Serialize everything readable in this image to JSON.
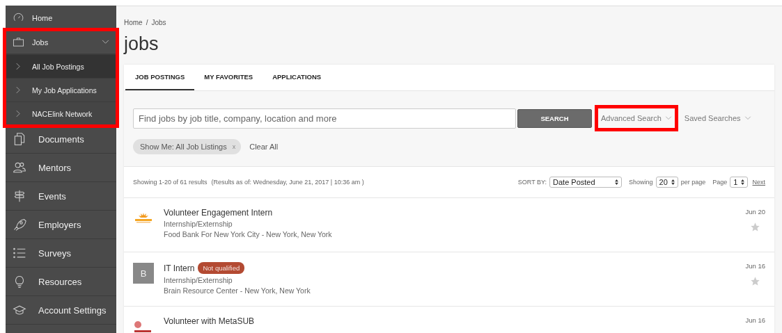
{
  "sidebar": {
    "items": [
      {
        "label": "Home",
        "highlighted": false
      },
      {
        "label": "Jobs",
        "expanded": true,
        "highlighted": true,
        "children": [
          {
            "label": "All Job Postings",
            "selected": true
          },
          {
            "label": "My Job Applications",
            "selected": false
          },
          {
            "label": "NACElink Network",
            "selected": false
          }
        ]
      },
      {
        "label": "Documents",
        "highlighted": false
      },
      {
        "label": "Mentors",
        "highlighted": false
      },
      {
        "label": "Events",
        "highlighted": false
      },
      {
        "label": "Employers",
        "highlighted": false
      },
      {
        "label": "Surveys",
        "highlighted": false
      },
      {
        "label": "Resources",
        "highlighted": false
      },
      {
        "label": "Account Settings",
        "highlighted": false
      }
    ]
  },
  "breadcrumb": [
    "Home",
    "Jobs"
  ],
  "breadcrumb_separator": "/",
  "page_title": "jobs",
  "tabs": [
    {
      "label": "JOB POSTINGS",
      "selected": true
    },
    {
      "label": "MY FAVORITES",
      "selected": false
    },
    {
      "label": "APPLICATIONS",
      "selected": false
    }
  ],
  "search": {
    "placeholder": "Find jobs by job title, company, location and more",
    "button": "SEARCH",
    "advanced": {
      "label": "Advanced Search",
      "highlighted": true
    },
    "saved": {
      "label": "Saved Searches",
      "highlighted": false
    }
  },
  "filters": [
    {
      "label": "Show Me: All Job Listings",
      "remove": "x"
    }
  ],
  "clear_all": "Clear All",
  "results": {
    "summary": "Showing 1-20 of 61 results",
    "as_of": "(Results as of: Wednesday, June 21, 2017 | 10:36 am )",
    "sort_label": "SORT BY:",
    "sort_value": "Date Posted",
    "showing_label": "Showing",
    "per_page_value": "20",
    "per_page_label": "per page",
    "page_label": "Page",
    "page_value": "1",
    "next": "Next"
  },
  "jobs": [
    {
      "title": "Volunteer Engagement Intern",
      "type": "Internship/Externship",
      "employer": "Food Bank For New York City - New York, New York",
      "date": "Jun 20",
      "favorite": false,
      "avatar": {
        "kind": "logo"
      }
    },
    {
      "title": "IT Intern",
      "badge": "Not qualified",
      "type": "Internship/Externship",
      "employer": "Brain Resource Center - New York, New York",
      "date": "Jun 16",
      "favorite": false,
      "avatar": {
        "kind": "letter",
        "text": "B"
      }
    },
    {
      "title": "Volunteer with MetaSUB",
      "date": "Jun 16",
      "avatar": {
        "kind": "seal"
      }
    }
  ]
}
